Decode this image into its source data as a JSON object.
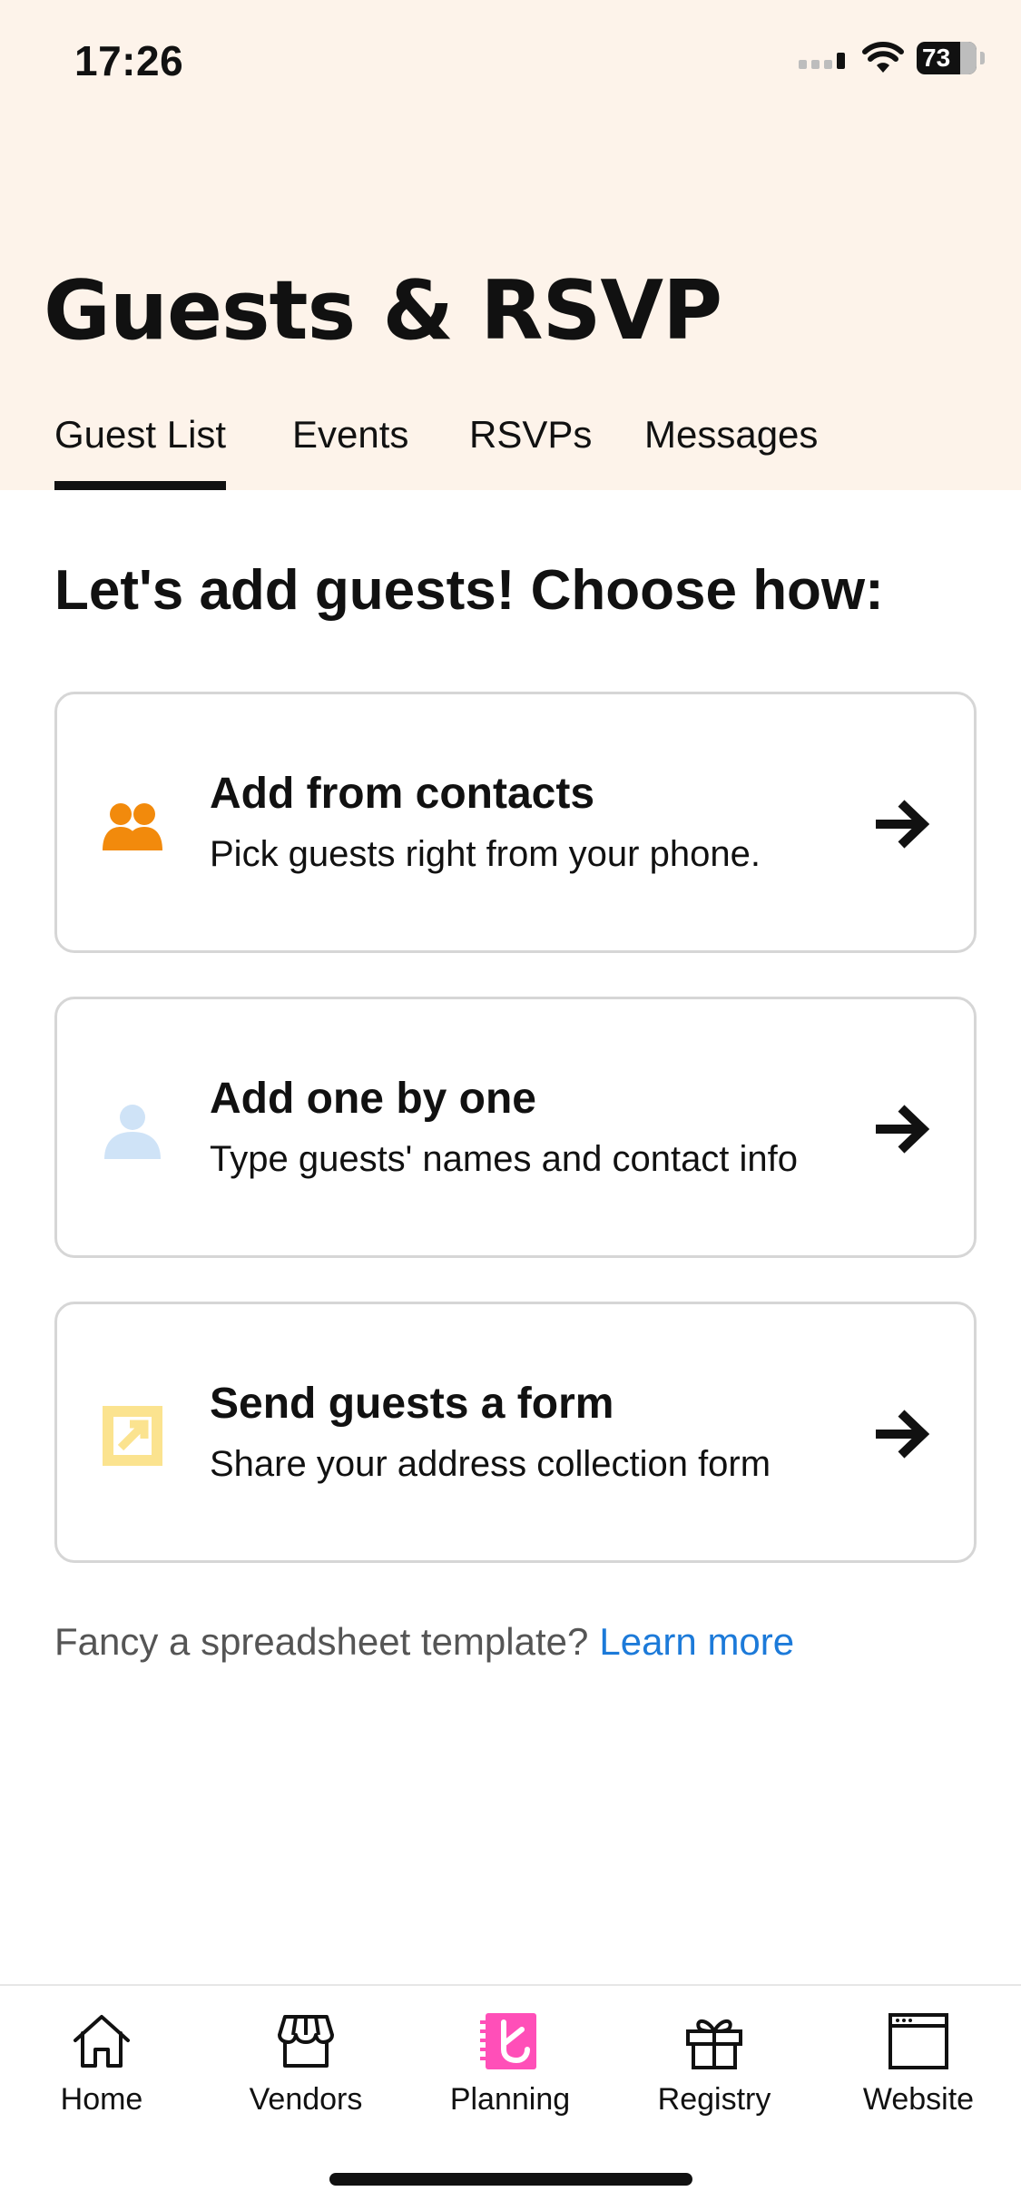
{
  "status_bar": {
    "time": "17:26",
    "battery": "73"
  },
  "header": {
    "title": "Guests & RSVP"
  },
  "tabs": [
    {
      "label": "Guest List",
      "active": true
    },
    {
      "label": "Events",
      "active": false
    },
    {
      "label": "RSVPs",
      "active": false
    },
    {
      "label": "Messages",
      "active": false
    }
  ],
  "main": {
    "heading": "Let's add guests! Choose how:",
    "options": [
      {
        "icon": "people-icon",
        "title": "Add from contacts",
        "description": "Pick guests right from your phone."
      },
      {
        "icon": "person-icon",
        "title": "Add one by one",
        "description": "Type guests' names and contact info"
      },
      {
        "icon": "share-form-icon",
        "title": "Send guests a form",
        "description": "Share your address collection form"
      }
    ],
    "footer_text": "Fancy a spreadsheet template?",
    "footer_link": "Learn more"
  },
  "bottom_nav": [
    {
      "label": "Home",
      "icon": "home-icon"
    },
    {
      "label": "Vendors",
      "icon": "storefront-icon"
    },
    {
      "label": "Planning",
      "icon": "planning-icon",
      "active": true
    },
    {
      "label": "Registry",
      "icon": "gift-icon"
    },
    {
      "label": "Website",
      "icon": "browser-window-icon"
    }
  ],
  "colors": {
    "header_bg": "#fdf3ea",
    "contacts_icon": "#f28a0c",
    "person_icon": "#cfe3f7",
    "form_icon": "#fbe38f",
    "planning_accent": "#ff4fb8",
    "link": "#1c7ad9"
  }
}
